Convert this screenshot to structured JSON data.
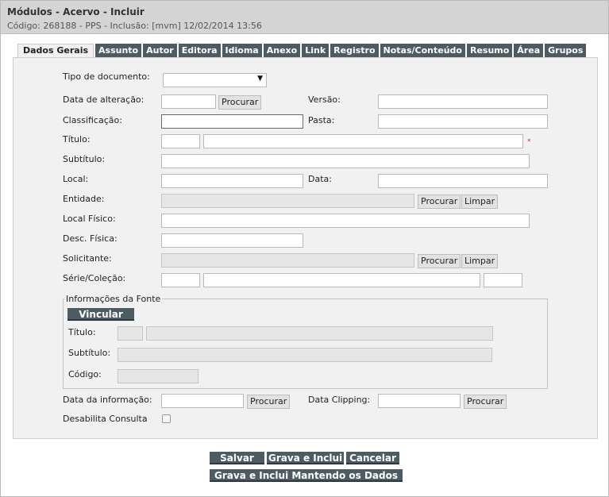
{
  "header": {
    "title": "Módulos - Acervo - Incluir",
    "subtitle": "Código: 268188 - PPS - Inclusão: [mvm] 12/02/2014 13:56"
  },
  "tabs": [
    {
      "label": "Dados Gerais"
    },
    {
      "label": "Assunto"
    },
    {
      "label": "Autor"
    },
    {
      "label": "Editora"
    },
    {
      "label": "Idioma"
    },
    {
      "label": "Anexo"
    },
    {
      "label": "Link"
    },
    {
      "label": "Registro"
    },
    {
      "label": "Notas/Conteúdo"
    },
    {
      "label": "Resumo"
    },
    {
      "label": "Área"
    },
    {
      "label": "Grupos"
    }
  ],
  "form": {
    "tipo_documento": "Tipo de documento:",
    "data_alteracao": "Data de alteração:",
    "versao": "Versão:",
    "classificacao": "Classificação:",
    "pasta": "Pasta:",
    "titulo": "Título:",
    "required_mark": "*",
    "subtitulo": "Subtítulo:",
    "local": "Local:",
    "data": "Data:",
    "entidade": "Entidade:",
    "local_fisico": "Local Físico:",
    "desc_fisica": "Desc. Física:",
    "solicitante": "Solicitante:",
    "serie_colecao": "Série/Coleção:",
    "data_informacao": "Data da informação:",
    "data_clipping": "Data Clipping:",
    "desabilita_consulta": "Desabilita Consulta"
  },
  "fonte": {
    "legend": "Informações da Fonte",
    "vincular": "Vincular",
    "titulo": "Título:",
    "subtitulo": "Subtítulo:",
    "codigo": "Código:"
  },
  "buttons": {
    "procurar": "Procurar",
    "limpar": "Limpar",
    "salvar": "Salvar",
    "grava_inclui": "Grava e Inclui",
    "cancelar": "Cancelar",
    "grava_inclui_mantendo": "Grava e Inclui Mantendo os Dados"
  },
  "icons": {
    "dropdown": "▼"
  }
}
